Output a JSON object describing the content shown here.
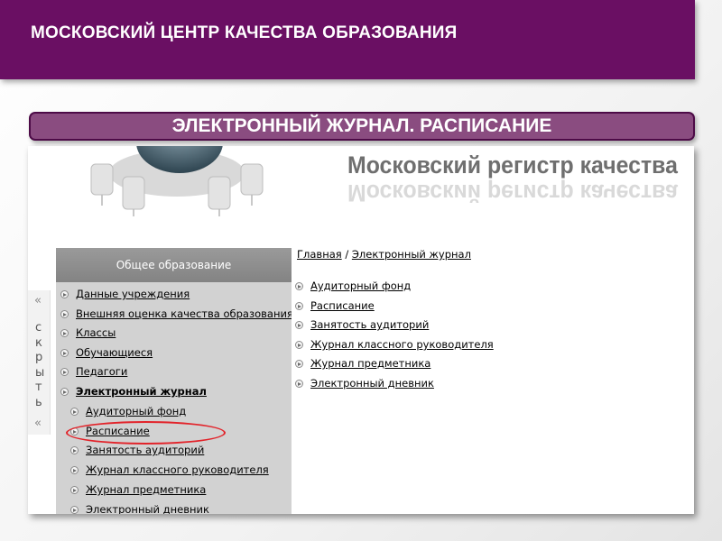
{
  "slide": {
    "header_title": "МОСКОВСКИЙ ЦЕНТР КАЧЕСТВА ОБРАЗОВАНИЯ",
    "section_title": "ЭЛЕКТРОННЫЙ ЖУРНАЛ. РАСПИСАНИЕ"
  },
  "site": {
    "banner_title": "Московский регистр качества",
    "side_panel": {
      "collapse_letters": [
        "с",
        "к",
        "р",
        "ы",
        "т",
        "ь"
      ],
      "arrow_up": "«",
      "arrow_down": "«"
    },
    "menu": {
      "header": "Общее образование",
      "items": [
        {
          "label": "Данные учреждения"
        },
        {
          "label": "Внешняя оценка качества образования"
        },
        {
          "label": "Классы"
        },
        {
          "label": "Обучающиеся"
        },
        {
          "label": "Педагоги"
        },
        {
          "label": "Электронный журнал"
        }
      ],
      "subitems": [
        {
          "label": "Аудиторный фонд"
        },
        {
          "label": "Расписание"
        },
        {
          "label": "Занятость аудиторий"
        },
        {
          "label": "Журнал классного руководителя"
        },
        {
          "label": "Журнал предметника"
        },
        {
          "label": "Электронный дневник"
        }
      ]
    },
    "breadcrumb": {
      "home": "Главная",
      "separator": "/",
      "current": "Электронный журнал"
    },
    "content_links": [
      {
        "label": "Аудиторный фонд"
      },
      {
        "label": "Расписание"
      },
      {
        "label": "Занятость аудиторий"
      },
      {
        "label": "Журнал классного руководителя"
      },
      {
        "label": "Журнал предметника"
      },
      {
        "label": "Электронный дневник"
      }
    ]
  },
  "colors": {
    "header_purple": "#6a0f63",
    "pill_purple": "#8a4c80",
    "highlight_red": "#e2232a",
    "menu_gray": "#d2d2d2"
  }
}
